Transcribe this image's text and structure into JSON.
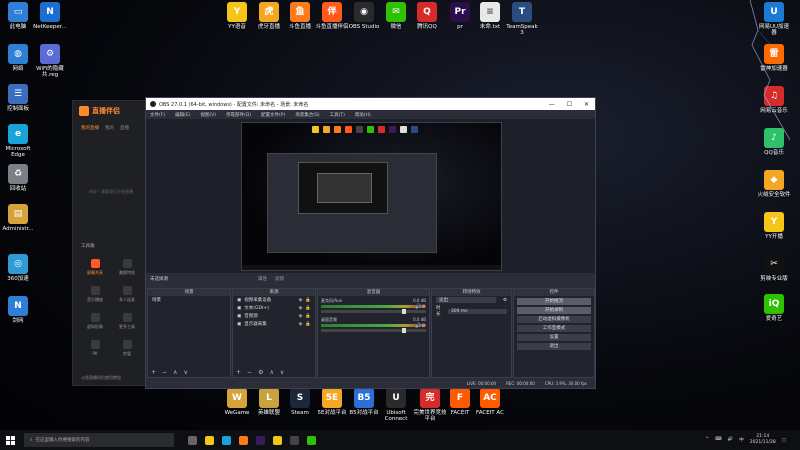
{
  "desktop": {
    "left_icons": [
      {
        "label": "此电脑",
        "color": "#2f7fd6",
        "glyph": "▭",
        "icon": "computer-icon"
      },
      {
        "label": "NetKeeper...",
        "color": "#1b6fd1",
        "glyph": "N",
        "icon": "netkeeper-icon"
      },
      {
        "label": "网络",
        "color": "#2f7fd6",
        "glyph": "◍",
        "icon": "network-icon"
      },
      {
        "label": "WiFi的隐藏\n共.reg",
        "color": "#5b6bd6",
        "glyph": "⚙",
        "icon": "reg-file-icon"
      },
      {
        "label": "控制面板",
        "color": "#3a6fc0",
        "glyph": "☰",
        "icon": "control-panel-icon"
      },
      {
        "label": "Microsoft\nEdge",
        "color": "#1aa3d8",
        "glyph": "e",
        "icon": "edge-icon"
      },
      {
        "label": "回收站",
        "color": "#7a7f88",
        "glyph": "♻",
        "icon": "recycle-bin-icon"
      },
      {
        "label": "Administr...",
        "color": "#d6a23a",
        "glyph": "▤",
        "icon": "user-folder-icon"
      },
      {
        "label": "360加速",
        "color": "#2f9bd6",
        "glyph": "◎",
        "icon": "speed-360-icon"
      },
      {
        "label": "剑网",
        "color": "#2f7fd6",
        "glyph": "N",
        "icon": "jianwang-icon"
      }
    ],
    "top_icons": [
      {
        "label": "YY语音",
        "color": "#f5c518",
        "glyph": "Y",
        "icon": "yy-icon"
      },
      {
        "label": "虎牙直播",
        "color": "#f5a623",
        "glyph": "虎",
        "icon": "huya-icon"
      },
      {
        "label": "斗鱼直播",
        "color": "#ff7a1a",
        "glyph": "鱼",
        "icon": "douyu-icon"
      },
      {
        "label": "斗鱼直播伴侣",
        "color": "#ff5a1a",
        "glyph": "伴",
        "icon": "douyu-companion-icon"
      },
      {
        "label": "OBS Studio",
        "color": "#2a2a2a",
        "glyph": "◉",
        "icon": "obs-icon"
      },
      {
        "label": "微信",
        "color": "#2dc100",
        "glyph": "✉",
        "icon": "wechat-icon"
      },
      {
        "label": "腾讯QQ",
        "color": "#d62b2b",
        "glyph": "Q",
        "icon": "qq-icon"
      },
      {
        "label": "pr",
        "color": "#2a0f4a",
        "glyph": "Pr",
        "icon": "premiere-icon"
      },
      {
        "label": "未命.txt",
        "color": "#e8e8e8",
        "glyph": "≡",
        "icon": "text-file-icon"
      },
      {
        "label": "TeamSpeak\n3",
        "color": "#2b4c7e",
        "glyph": "T",
        "icon": "teamspeak-icon"
      }
    ],
    "right_icons": [
      {
        "label": "网易UU加速\n器",
        "color": "#1b7ad6",
        "glyph": "U",
        "icon": "uu-icon"
      },
      {
        "label": "雷神加速器",
        "color": "#ff6a00",
        "glyph": "雷",
        "icon": "leishen-icon"
      },
      {
        "label": "网易云音乐",
        "color": "#d62b2b",
        "glyph": "♫",
        "icon": "netease-music-icon"
      },
      {
        "label": "QQ音乐",
        "color": "#2dc16b",
        "glyph": "♪",
        "icon": "qq-music-icon"
      },
      {
        "label": "火绒安全软件",
        "color": "#f5a623",
        "glyph": "◆",
        "icon": "huorong-icon"
      },
      {
        "label": "YY开播",
        "color": "#f5c518",
        "glyph": "Y",
        "icon": "yy-live-icon"
      },
      {
        "label": "剪映专业版",
        "color": "#111111",
        "glyph": "✂",
        "icon": "jianying-icon"
      },
      {
        "label": "爱奇艺",
        "color": "#2dc100",
        "glyph": "iQ",
        "icon": "iqiyi-icon"
      }
    ],
    "bottom_icons": [
      {
        "label": "WeGame",
        "color": "#d6a23a",
        "glyph": "W",
        "icon": "wegame-icon"
      },
      {
        "label": "英雄联盟",
        "color": "#c8a23a",
        "glyph": "L",
        "icon": "lol-icon"
      },
      {
        "label": "Steam",
        "color": "#1b2838",
        "glyph": "S",
        "icon": "steam-icon"
      },
      {
        "label": "5E对战平台",
        "color": "#f5a623",
        "glyph": "5E",
        "icon": "5e-icon"
      },
      {
        "label": "B5对战平台",
        "color": "#2a6fd6",
        "glyph": "B5",
        "icon": "b5-icon"
      },
      {
        "label": "Ubisoft\nConnect",
        "color": "#2a2a2a",
        "glyph": "U",
        "icon": "ubisoft-icon"
      },
      {
        "label": "完美世界竞技\n平台",
        "color": "#d62b2b",
        "glyph": "完",
        "icon": "perfect-world-icon"
      },
      {
        "label": "FACEIT",
        "color": "#ff5a00",
        "glyph": "F",
        "icon": "faceit-icon"
      },
      {
        "label": "FACEIT AC",
        "color": "#ff5a00",
        "glyph": "AC",
        "icon": "faceit-ac-icon"
      }
    ]
  },
  "launcher": {
    "brand": "直播伴侣",
    "tabs": [
      "我的直播",
      "我的",
      "直播"
    ],
    "hint": "你好 ! 请登录后开始直播",
    "toolbox": "工具箱",
    "tools": [
      {
        "label": "屏幕共享"
      },
      {
        "label": "美颜特效"
      },
      {
        "label": "音乐播放"
      },
      {
        "label": "多人连麦"
      },
      {
        "label": "虚拟形象"
      },
      {
        "label": "更多工具"
      },
      {
        "label": "PK"
      },
      {
        "label": "房管"
      }
    ],
    "footer": "斗鱼直播伴侣使用教程"
  },
  "obs": {
    "title": "OBS 27.0.1 (64-bit, windows) - 配置文件: 未命名 - 场景: 未命名",
    "controls": [
      "—",
      "☐",
      "✕"
    ],
    "menus": [
      "文件(F)",
      "编辑(E)",
      "视图(V)",
      "停靠部件(D)",
      "配置文件(P)",
      "场景集合(S)",
      "工具(T)",
      "帮助(H)"
    ],
    "source_selected": "未选择源",
    "props_buttons": [
      "属性",
      "滤镜"
    ],
    "docks": {
      "scenes": {
        "title": "场景",
        "items": [
          "场景"
        ]
      },
      "sources": {
        "title": "来源",
        "items": [
          "视频采集设备",
          "文本(GDI+)",
          "音频源",
          "显示器采集"
        ]
      },
      "mixer": {
        "title": "混音器",
        "rows": [
          {
            "name": "麦克风/Aux",
            "db": "0.0 dB"
          },
          {
            "name": "桌面音频",
            "db": "0.0 dB"
          }
        ]
      },
      "transitions": {
        "title": "转场特效",
        "type": "淡出",
        "duration_label": "时长",
        "duration": "300 ms"
      },
      "controls": {
        "title": "控件",
        "buttons": [
          "开始推流",
          "开始录制",
          "启动虚拟摄像机",
          "工作室模式",
          "设置",
          "退出"
        ]
      }
    },
    "status": [
      "LIVE: 00:00:00",
      "REC: 00:00:00",
      "CPU: 3.9%, 30.00 fps"
    ]
  },
  "taskbar": {
    "search_placeholder": "在这里输入你要搜索的内容",
    "time": "21:14",
    "date": "2021/11/28",
    "apps": [
      {
        "icon": "task-view-icon",
        "color": "#666666"
      },
      {
        "icon": "explorer-icon",
        "color": "#f5c518"
      },
      {
        "icon": "edge-icon",
        "color": "#1aa3d8"
      },
      {
        "icon": "douyu-icon",
        "color": "#ff7a1a"
      },
      {
        "icon": "pr-icon",
        "color": "#3a1a5a"
      },
      {
        "icon": "yy-icon",
        "color": "#f5c518"
      },
      {
        "icon": "obs-icon",
        "color": "#444444"
      },
      {
        "icon": "wechat-icon",
        "color": "#2dc100"
      }
    ],
    "tray_icons": [
      "^",
      "⌨",
      "🔊",
      "中"
    ]
  }
}
